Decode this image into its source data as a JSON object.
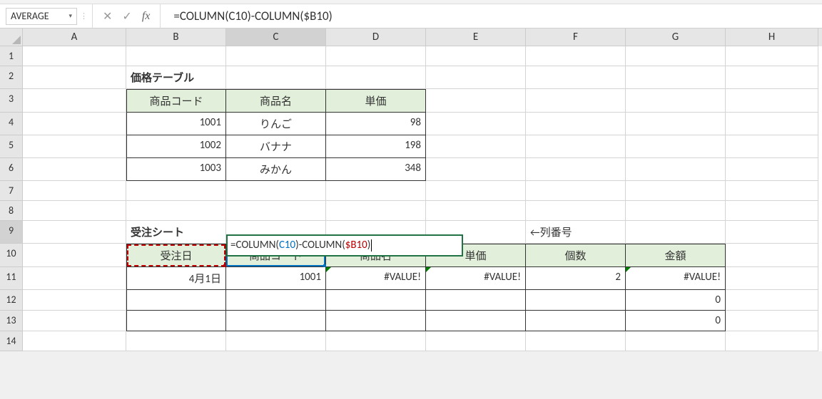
{
  "namebox": {
    "value": "AVERAGE"
  },
  "formula_bar": {
    "text": "=COLUMN(C10)-COLUMN($B10)"
  },
  "columns": [
    "A",
    "B",
    "C",
    "D",
    "E",
    "F",
    "G",
    "H"
  ],
  "rows": [
    1,
    2,
    3,
    4,
    5,
    6,
    7,
    8,
    9,
    10,
    11,
    12,
    13,
    14
  ],
  "active_column": "C",
  "active_row": 9,
  "labels": {
    "price_table_title": "価格テーブル",
    "price_table_headers": {
      "code": "商品コード",
      "name": "商品名",
      "unit_price": "単価"
    },
    "orders_title": "受注シート",
    "col_label_note": "←列番号",
    "orders_headers": {
      "order_date": "受注日",
      "product_code": "商品コード",
      "product_name": "商品名",
      "unit_price": "単価",
      "qty": "個数",
      "amount": "金額"
    }
  },
  "editing_cell": {
    "address": "C9",
    "display_formula": "=COLUMN(C10)-COLUMN($B10)",
    "parts": [
      "=COLUMN(",
      "C10",
      ")-COLUMN(",
      "$B10",
      ")"
    ]
  },
  "price_table": [
    {
      "code": "1001",
      "name": "りんご",
      "unit_price": "98"
    },
    {
      "code": "1002",
      "name": "バナナ",
      "unit_price": "198"
    },
    {
      "code": "1003",
      "name": "みかん",
      "unit_price": "348"
    }
  ],
  "orders": [
    {
      "order_date": "4月1日",
      "product_code": "1001",
      "product_name": "#VALUE!",
      "unit_price": "#VALUE!",
      "qty": "2",
      "amount": "#VALUE!"
    },
    {
      "order_date": "",
      "product_code": "",
      "product_name": "",
      "unit_price": "",
      "qty": "",
      "amount": "0"
    },
    {
      "order_date": "",
      "product_code": "",
      "product_name": "",
      "unit_price": "",
      "qty": "",
      "amount": "0"
    }
  ]
}
